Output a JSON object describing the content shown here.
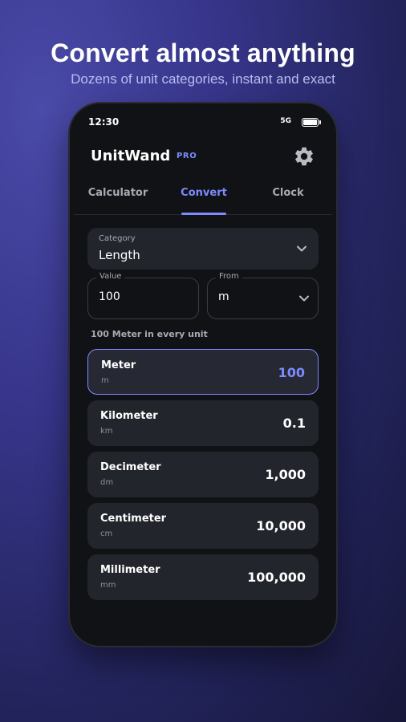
{
  "promo": {
    "headline": "Convert almost anything",
    "subline": "Dozens of unit categories, instant and exact"
  },
  "status_bar": {
    "time": "12:30",
    "network": "5G"
  },
  "app": {
    "name": "UnitWand",
    "badge": "PRO"
  },
  "tabs": [
    {
      "label": "Calculator",
      "active": false
    },
    {
      "label": "Convert",
      "active": true
    },
    {
      "label": "Clock",
      "active": false
    }
  ],
  "form": {
    "category": {
      "label": "Category",
      "value": "Length"
    },
    "value": {
      "label": "Value",
      "value": "100"
    },
    "from": {
      "label": "From",
      "value": "m"
    }
  },
  "results": {
    "title": "100 Meter in every unit",
    "rows": [
      {
        "name": "Meter",
        "symbol": "m",
        "value": "100",
        "selected": true
      },
      {
        "name": "Kilometer",
        "symbol": "km",
        "value": "0.1",
        "selected": false
      },
      {
        "name": "Decimeter",
        "symbol": "dm",
        "value": "1,000",
        "selected": false
      },
      {
        "name": "Centimeter",
        "symbol": "cm",
        "value": "10,000",
        "selected": false
      },
      {
        "name": "Millimeter",
        "symbol": "mm",
        "value": "100,000",
        "selected": false
      }
    ]
  },
  "colors": {
    "accent": "#7c8cff",
    "screen_bg": "#111216",
    "card_bg": "#23252c"
  },
  "icons": [
    "settings-gear-icon",
    "chevron-down-icon",
    "battery-icon"
  ]
}
